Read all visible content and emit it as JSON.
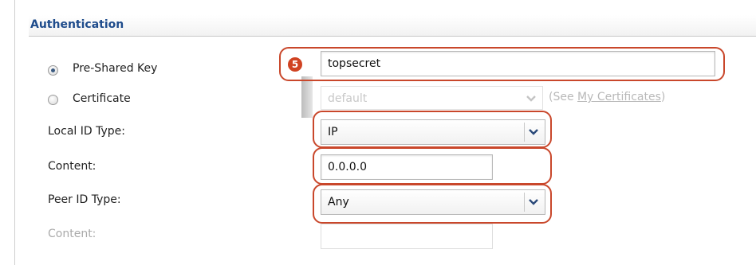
{
  "section": {
    "title": "Authentication"
  },
  "auth_method": {
    "psk_label": "Pre-Shared Key",
    "psk_selected": true,
    "cert_label": "Certificate",
    "cert_selected": false
  },
  "psk": {
    "value": "topsecret",
    "callout": "5"
  },
  "certificate": {
    "value": "default",
    "hint_prefix": "(See ",
    "hint_link": "My Certificates",
    "hint_suffix": ")"
  },
  "local_id_type": {
    "label": "Local ID Type:",
    "value": "IP"
  },
  "local_content": {
    "label": "Content:",
    "value": "0.0.0.0"
  },
  "peer_id_type": {
    "label": "Peer ID Type:",
    "value": "Any"
  },
  "peer_content": {
    "label": "Content:",
    "value": ""
  },
  "colors": {
    "accent_title": "#1f4c8c",
    "highlight": "#c9472b",
    "badge": "#d04322"
  }
}
